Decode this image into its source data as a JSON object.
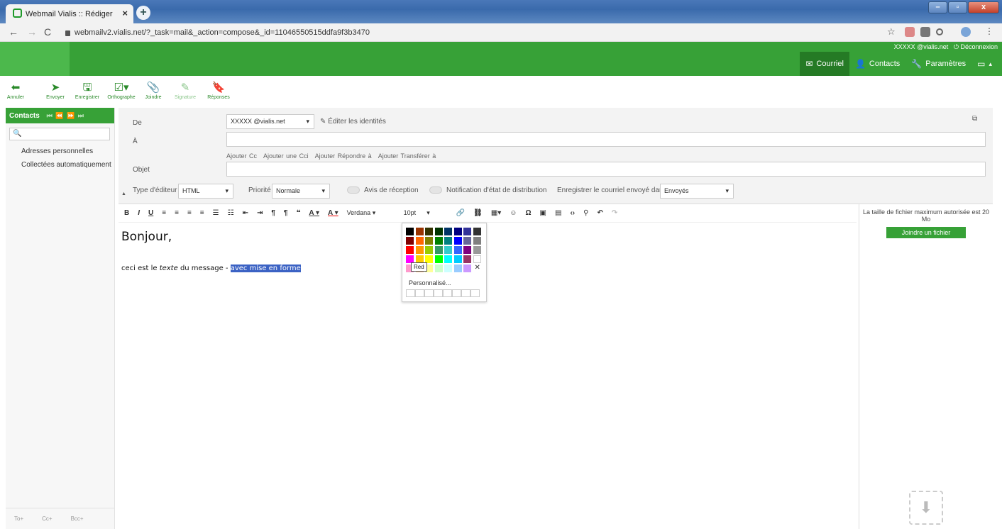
{
  "browser": {
    "tab_title": "Webmail Vialis :: Rédiger",
    "url": "webmailv2.vialis.net/?_task=mail&_action=compose&_id=11046550515ddfa9f3b3470"
  },
  "header": {
    "user": "XXXXX @vialis.net",
    "logout": "Déconnexion",
    "nav": [
      {
        "label": "Courriel",
        "icon": "mail-icon"
      },
      {
        "label": "Contacts",
        "icon": "contacts-icon"
      },
      {
        "label": "Paramètres",
        "icon": "wrench-icon"
      }
    ]
  },
  "toolbar": [
    {
      "label": "Annuler",
      "icon": "cancel-icon"
    },
    {
      "label": "Envoyer",
      "icon": "send-icon"
    },
    {
      "label": "Enregistrer",
      "icon": "save-icon"
    },
    {
      "label": "Orthographe",
      "icon": "spellcheck-icon"
    },
    {
      "label": "Joindre",
      "icon": "paperclip-icon"
    },
    {
      "label": "Signature",
      "icon": "signature-icon"
    },
    {
      "label": "Réponses",
      "icon": "bookmark-icon"
    }
  ],
  "sidebar": {
    "title": "Contacts",
    "search_placeholder": "",
    "items": [
      "Adresses personnelles",
      "Collectées automatiquement"
    ],
    "footer": [
      "To+",
      "Cc+",
      "Bcc+"
    ]
  },
  "compose": {
    "from_label": "De",
    "from_value": "XXXXX @vialis.net",
    "edit_identities": "Éditer les identités",
    "to_label": "À",
    "add_links": [
      "Ajouter Cc",
      "Ajouter une Cci",
      "Ajouter Répondre à",
      "Ajouter Transférer à"
    ],
    "subject_label": "Objet",
    "editor_type_label": "Type d'éditeur",
    "editor_type_value": "HTML",
    "priority_label": "Priorité",
    "priority_value": "Normale",
    "receipt_label": "Avis de réception",
    "dsn_label": "Notification d'état de distribution",
    "save_in_label": "Enregistrer le courriel envoyé dans",
    "save_in_value": "Envoyés"
  },
  "editor": {
    "font": "Verdana",
    "size": "10pt",
    "greeting": "Bonjour,",
    "msg_start": "ceci est le ",
    "msg_italic": "texte",
    "msg_mid": " du message - ",
    "msg_selected": "avec mise en forme"
  },
  "colorpicker": {
    "tooltip": "Red",
    "custom_label": "Personnalisé...",
    "colors": [
      [
        "#000000",
        "#993300",
        "#333300",
        "#003300",
        "#003366",
        "#000080",
        "#333399",
        "#333333"
      ],
      [
        "#800000",
        "#FF6600",
        "#808000",
        "#008000",
        "#008080",
        "#0000FF",
        "#666699",
        "#808080"
      ],
      [
        "#FF0000",
        "#FF9900",
        "#99CC00",
        "#339966",
        "#33CCCC",
        "#3366FF",
        "#800080",
        "#999999"
      ],
      [
        "#FF00FF",
        "#FFCC00",
        "#FFFF00",
        "#00FF00",
        "#00FFFF",
        "#00CCFF",
        "#993366",
        "#FFFFFF"
      ],
      [
        "#FF99CC",
        "#FFCC99",
        "#FFFF99",
        "#CCFFCC",
        "#CCFFFF",
        "#99CCFF",
        "#CC99FF",
        ""
      ]
    ]
  },
  "attachments": {
    "max_size": "La taille de fichier maximum autorisée est 20 Mo",
    "button": "Joindre un fichier"
  }
}
